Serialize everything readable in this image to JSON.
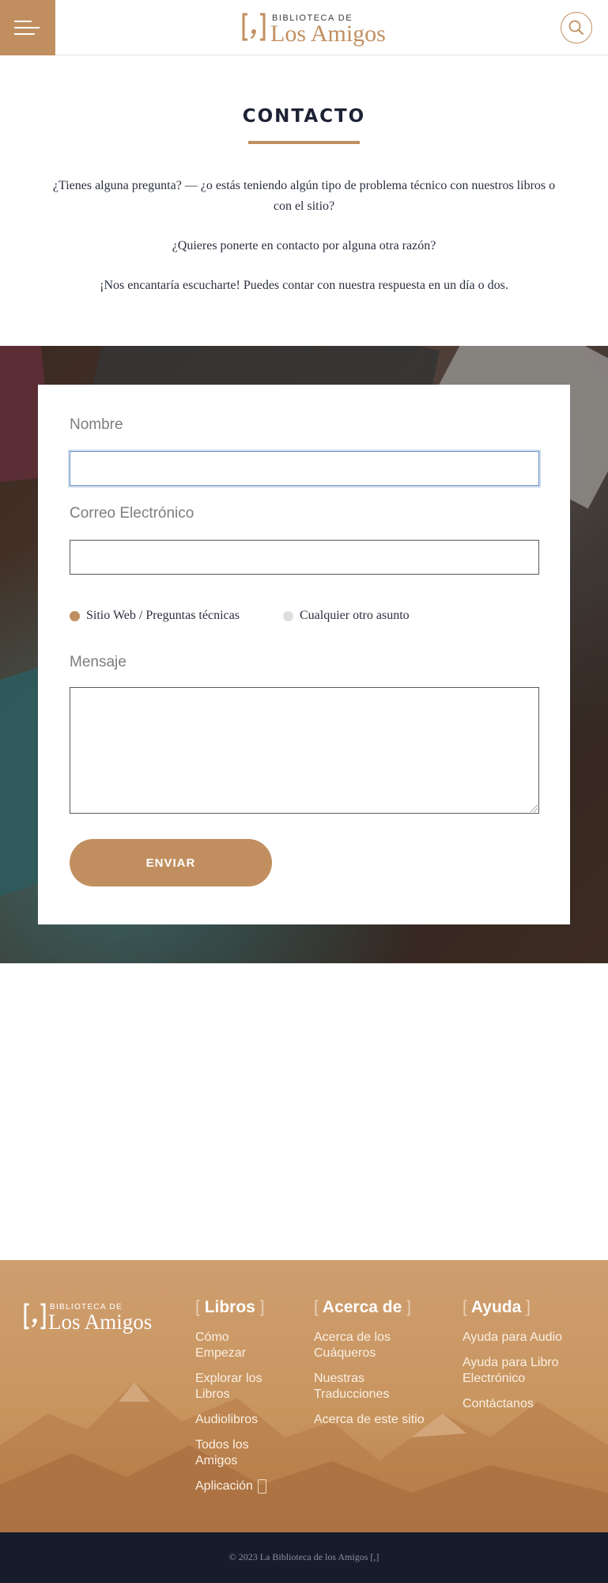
{
  "header": {
    "logo_small": "BIBLIOTECA DE",
    "logo_big": "Los Amigos",
    "menu_icon": "hamburger-menu-icon",
    "search_icon": "search-icon"
  },
  "intro": {
    "title": "CONTACTO",
    "paragraph1": "¿Tienes alguna pregunta? — ¿o estás teniendo algún tipo de problema técnico con nuestros libros o con el sitio?",
    "paragraph2": "¿Quieres ponerte en contacto por alguna otra razón?",
    "paragraph3": "¡Nos encantaría escucharte! Puedes contar con nuestra respuesta en un día o dos."
  },
  "form": {
    "name_label": "Nombre",
    "name_value": "",
    "email_label": "Correo Electrónico",
    "email_value": "",
    "radio_web": "Sitio Web / Preguntas técnicas",
    "radio_other": "Cualquier otro asunto",
    "selected_topic": "Sitio Web / Preguntas técnicas",
    "message_label": "Mensaje",
    "message_value": "",
    "submit_label": "ENVIAR"
  },
  "footer": {
    "logo_small": "BIBLIOTECA DE",
    "logo_big": "Los Amigos",
    "columns": [
      {
        "heading": "Libros",
        "links": [
          "Cómo Empezar",
          "Explorar los Libros",
          "Audiolibros",
          "Todos los Amigos",
          "Aplicación"
        ]
      },
      {
        "heading": "Acerca de",
        "links": [
          "Acerca de los Cuáqueros",
          "Nuestras Traducciones",
          "Acerca de este sitio"
        ]
      },
      {
        "heading": "Ayuda",
        "links": [
          "Ayuda para Audio",
          "Ayuda para Libro Electrónico",
          "Contáctanos"
        ]
      }
    ],
    "bracket_open": "[",
    "bracket_close": "]",
    "copyright": "© 2023 La Biblioteca de los Amigos [,]"
  },
  "colors": {
    "accent": "#c18f5f",
    "dark_navy": "#171c2c",
    "text": "#1d2235"
  }
}
